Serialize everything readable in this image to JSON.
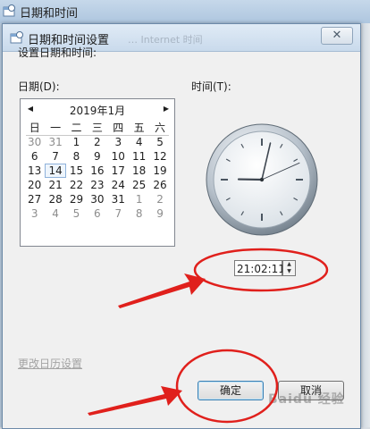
{
  "parent_window": {
    "title": "日期和时间"
  },
  "dialog": {
    "title": "日期和时间设置",
    "ghost_text": "…  Internet 时间",
    "close_symbol": "✕",
    "subheading": "设置日期和时间:",
    "date_label": "日期(D):",
    "time_label": "时间(T):",
    "calendar_settings_link": "更改日历设置",
    "ok_label": "确定",
    "cancel_label": "取消"
  },
  "calendar": {
    "month_label": "2019年1月",
    "prev_icon": "◀",
    "next_icon": "▶",
    "weekdays": [
      "日",
      "一",
      "二",
      "三",
      "四",
      "五",
      "六"
    ],
    "weeks": [
      [
        "30",
        "31",
        "1",
        "2",
        "3",
        "4",
        "5"
      ],
      [
        "6",
        "7",
        "8",
        "9",
        "10",
        "11",
        "12"
      ],
      [
        "13",
        "14",
        "15",
        "16",
        "17",
        "18",
        "19"
      ],
      [
        "20",
        "21",
        "22",
        "23",
        "24",
        "25",
        "26"
      ],
      [
        "27",
        "28",
        "29",
        "30",
        "31",
        "1",
        "2"
      ],
      [
        "3",
        "4",
        "5",
        "6",
        "7",
        "8",
        "9"
      ]
    ],
    "selected_day": "14"
  },
  "time": {
    "value": "21:02:11",
    "spin_up": "▲",
    "spin_down": "▼"
  },
  "watermark": "Baidu 经验",
  "colors": {
    "annotation_red": "#e0201c",
    "accent_blue": "#3c7fb1"
  }
}
